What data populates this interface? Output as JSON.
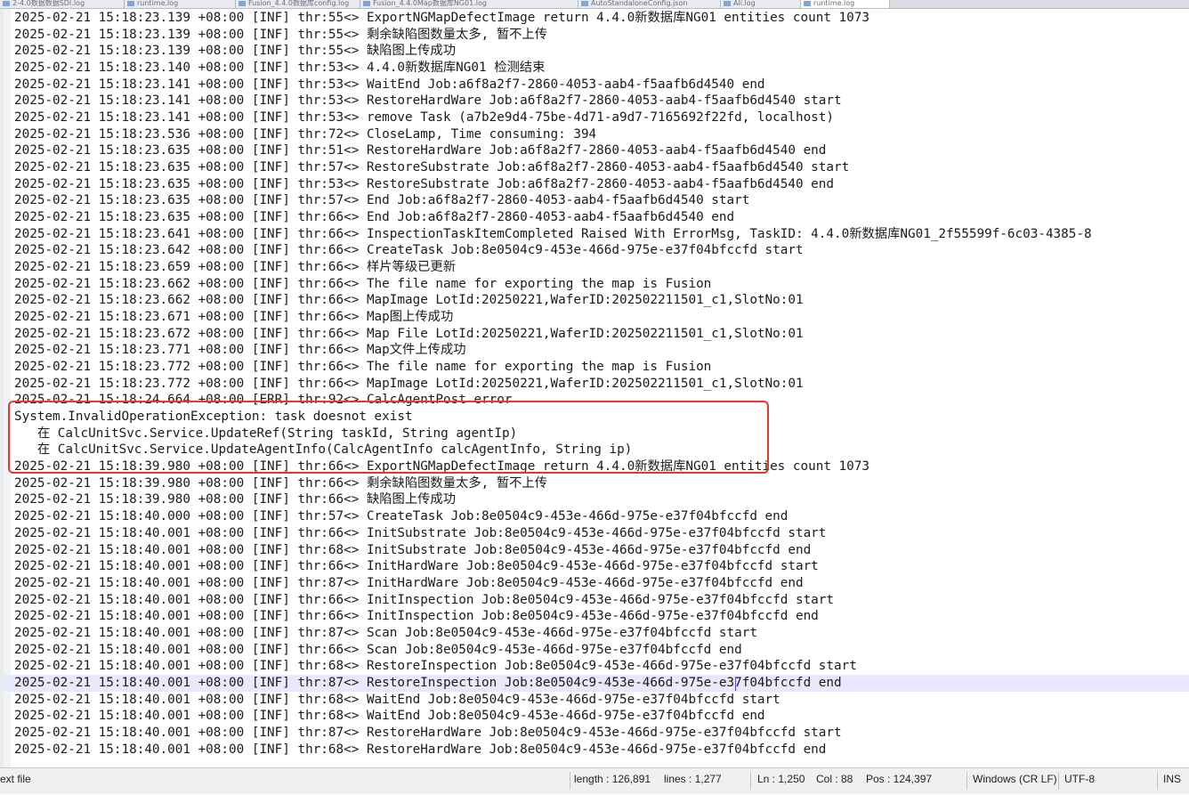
{
  "tabs": [
    {
      "label": "2-4.0数据数据SDI.log"
    },
    {
      "label": "runtime.log"
    },
    {
      "label": "Fusion_4.4.0数据库config.log"
    },
    {
      "label": "Fusion_4.4.0Map数据库NG01.log"
    },
    {
      "label": "AutoStandaloneConfig.json"
    },
    {
      "label": "Ali.log"
    },
    {
      "label": "runtime.log"
    }
  ],
  "editor": {
    "lines": [
      "2025-02-21 15:18:23.139 +08:00 [INF] thr:55<> ExportNGMapDefectImage return 4.4.0新数据库NG01 entities count 1073",
      "2025-02-21 15:18:23.139 +08:00 [INF] thr:55<> 剩余缺陷图数量太多, 暂不上传",
      "2025-02-21 15:18:23.139 +08:00 [INF] thr:55<> 缺陷图上传成功",
      "2025-02-21 15:18:23.140 +08:00 [INF] thr:53<> 4.4.0新数据库NG01 检测结束",
      "2025-02-21 15:18:23.141 +08:00 [INF] thr:53<> WaitEnd Job:a6f8a2f7-2860-4053-aab4-f5aafb6d4540 end",
      "2025-02-21 15:18:23.141 +08:00 [INF] thr:53<> RestoreHardWare Job:a6f8a2f7-2860-4053-aab4-f5aafb6d4540 start",
      "2025-02-21 15:18:23.141 +08:00 [INF] thr:53<> remove Task (a7b2e9d4-75be-4d71-a9d7-7165692f22fd, localhost)",
      "2025-02-21 15:18:23.536 +08:00 [INF] thr:72<> CloseLamp, Time consuming: 394",
      "2025-02-21 15:18:23.635 +08:00 [INF] thr:51<> RestoreHardWare Job:a6f8a2f7-2860-4053-aab4-f5aafb6d4540 end",
      "2025-02-21 15:18:23.635 +08:00 [INF] thr:57<> RestoreSubstrate Job:a6f8a2f7-2860-4053-aab4-f5aafb6d4540 start",
      "2025-02-21 15:18:23.635 +08:00 [INF] thr:53<> RestoreSubstrate Job:a6f8a2f7-2860-4053-aab4-f5aafb6d4540 end",
      "2025-02-21 15:18:23.635 +08:00 [INF] thr:57<> End Job:a6f8a2f7-2860-4053-aab4-f5aafb6d4540 start",
      "2025-02-21 15:18:23.635 +08:00 [INF] thr:66<> End Job:a6f8a2f7-2860-4053-aab4-f5aafb6d4540 end",
      "2025-02-21 15:18:23.641 +08:00 [INF] thr:66<> InspectionTaskItemCompleted Raised With ErrorMsg, TaskID: 4.4.0新数据库NG01_2f55599f-6c03-4385-8",
      "2025-02-21 15:18:23.642 +08:00 [INF] thr:66<> CreateTask Job:8e0504c9-453e-466d-975e-e37f04bfccfd start",
      "2025-02-21 15:18:23.659 +08:00 [INF] thr:66<> 样片等级已更新",
      "2025-02-21 15:18:23.662 +08:00 [INF] thr:66<> The file name for exporting the map is Fusion",
      "2025-02-21 15:18:23.662 +08:00 [INF] thr:66<> MapImage LotId:20250221,WaferID:202502211501_c1,SlotNo:01",
      "2025-02-21 15:18:23.671 +08:00 [INF] thr:66<> Map图上传成功",
      "2025-02-21 15:18:23.672 +08:00 [INF] thr:66<> Map File LotId:20250221,WaferID:202502211501_c1,SlotNo:01",
      "2025-02-21 15:18:23.771 +08:00 [INF] thr:66<> Map文件上传成功",
      "2025-02-21 15:18:23.772 +08:00 [INF] thr:66<> The file name for exporting the map is Fusion",
      "2025-02-21 15:18:23.772 +08:00 [INF] thr:66<> MapImage LotId:20250221,WaferID:202502211501_c1,SlotNo:01",
      "2025-02-21 15:18:24.664 +08:00 [ERR] thr:92<> CalcAgentPost error",
      "System.InvalidOperationException: task doesnot exist",
      "   在 CalcUnitSvc.Service.UpdateRef(String taskId, String agentIp)",
      "   在 CalcUnitSvc.Service.UpdateAgentInfo(CalcAgentInfo calcAgentInfo, String ip)",
      "2025-02-21 15:18:39.980 +08:00 [INF] thr:66<> ExportNGMapDefectImage return 4.4.0新数据库NG01 entities count 1073",
      "2025-02-21 15:18:39.980 +08:00 [INF] thr:66<> 剩余缺陷图数量太多, 暂不上传",
      "2025-02-21 15:18:39.980 +08:00 [INF] thr:66<> 缺陷图上传成功",
      "2025-02-21 15:18:40.000 +08:00 [INF] thr:57<> CreateTask Job:8e0504c9-453e-466d-975e-e37f04bfccfd end",
      "2025-02-21 15:18:40.001 +08:00 [INF] thr:66<> InitSubstrate Job:8e0504c9-453e-466d-975e-e37f04bfccfd start",
      "2025-02-21 15:18:40.001 +08:00 [INF] thr:68<> InitSubstrate Job:8e0504c9-453e-466d-975e-e37f04bfccfd end",
      "2025-02-21 15:18:40.001 +08:00 [INF] thr:66<> InitHardWare Job:8e0504c9-453e-466d-975e-e37f04bfccfd start",
      "2025-02-21 15:18:40.001 +08:00 [INF] thr:87<> InitHardWare Job:8e0504c9-453e-466d-975e-e37f04bfccfd end",
      "2025-02-21 15:18:40.001 +08:00 [INF] thr:66<> InitInspection Job:8e0504c9-453e-466d-975e-e37f04bfccfd start",
      "2025-02-21 15:18:40.001 +08:00 [INF] thr:66<> InitInspection Job:8e0504c9-453e-466d-975e-e37f04bfccfd end",
      "2025-02-21 15:18:40.001 +08:00 [INF] thr:87<> Scan Job:8e0504c9-453e-466d-975e-e37f04bfccfd start",
      "2025-02-21 15:18:40.001 +08:00 [INF] thr:66<> Scan Job:8e0504c9-453e-466d-975e-e37f04bfccfd end",
      "2025-02-21 15:18:40.001 +08:00 [INF] thr:68<> RestoreInspection Job:8e0504c9-453e-466d-975e-e37f04bfccfd start",
      "2025-02-21 15:18:40.001 +08:00 [INF] thr:87<> RestoreInspection Job:8e0504c9-453e-466d-975e-e37f04bfccfd end",
      "2025-02-21 15:18:40.001 +08:00 [INF] thr:68<> WaitEnd Job:8e0504c9-453e-466d-975e-e37f04bfccfd start",
      "2025-02-21 15:18:40.001 +08:00 [INF] thr:68<> WaitEnd Job:8e0504c9-453e-466d-975e-e37f04bfccfd end",
      "2025-02-21 15:18:40.001 +08:00 [INF] thr:87<> RestoreHardWare Job:8e0504c9-453e-466d-975e-e37f04bfccfd start",
      "2025-02-21 15:18:40.001 +08:00 [INF] thr:68<> RestoreHardWare Job:8e0504c9-453e-466d-975e-e37f04bfccfd end"
    ]
  },
  "status_bar": {
    "file_type": "ext file",
    "length": "length : 126,891",
    "lines": "lines : 1,277",
    "ln": "Ln : 1,250",
    "col": "Col : 88",
    "pos": "Pos : 124,397",
    "eol": "Windows (CR LF)",
    "encoding": "UTF-8",
    "mode": "INS"
  },
  "colors": {
    "highlight_box": "#e23a2e",
    "current_line": "#e8e8ff",
    "caret": "#6a3fe0"
  }
}
